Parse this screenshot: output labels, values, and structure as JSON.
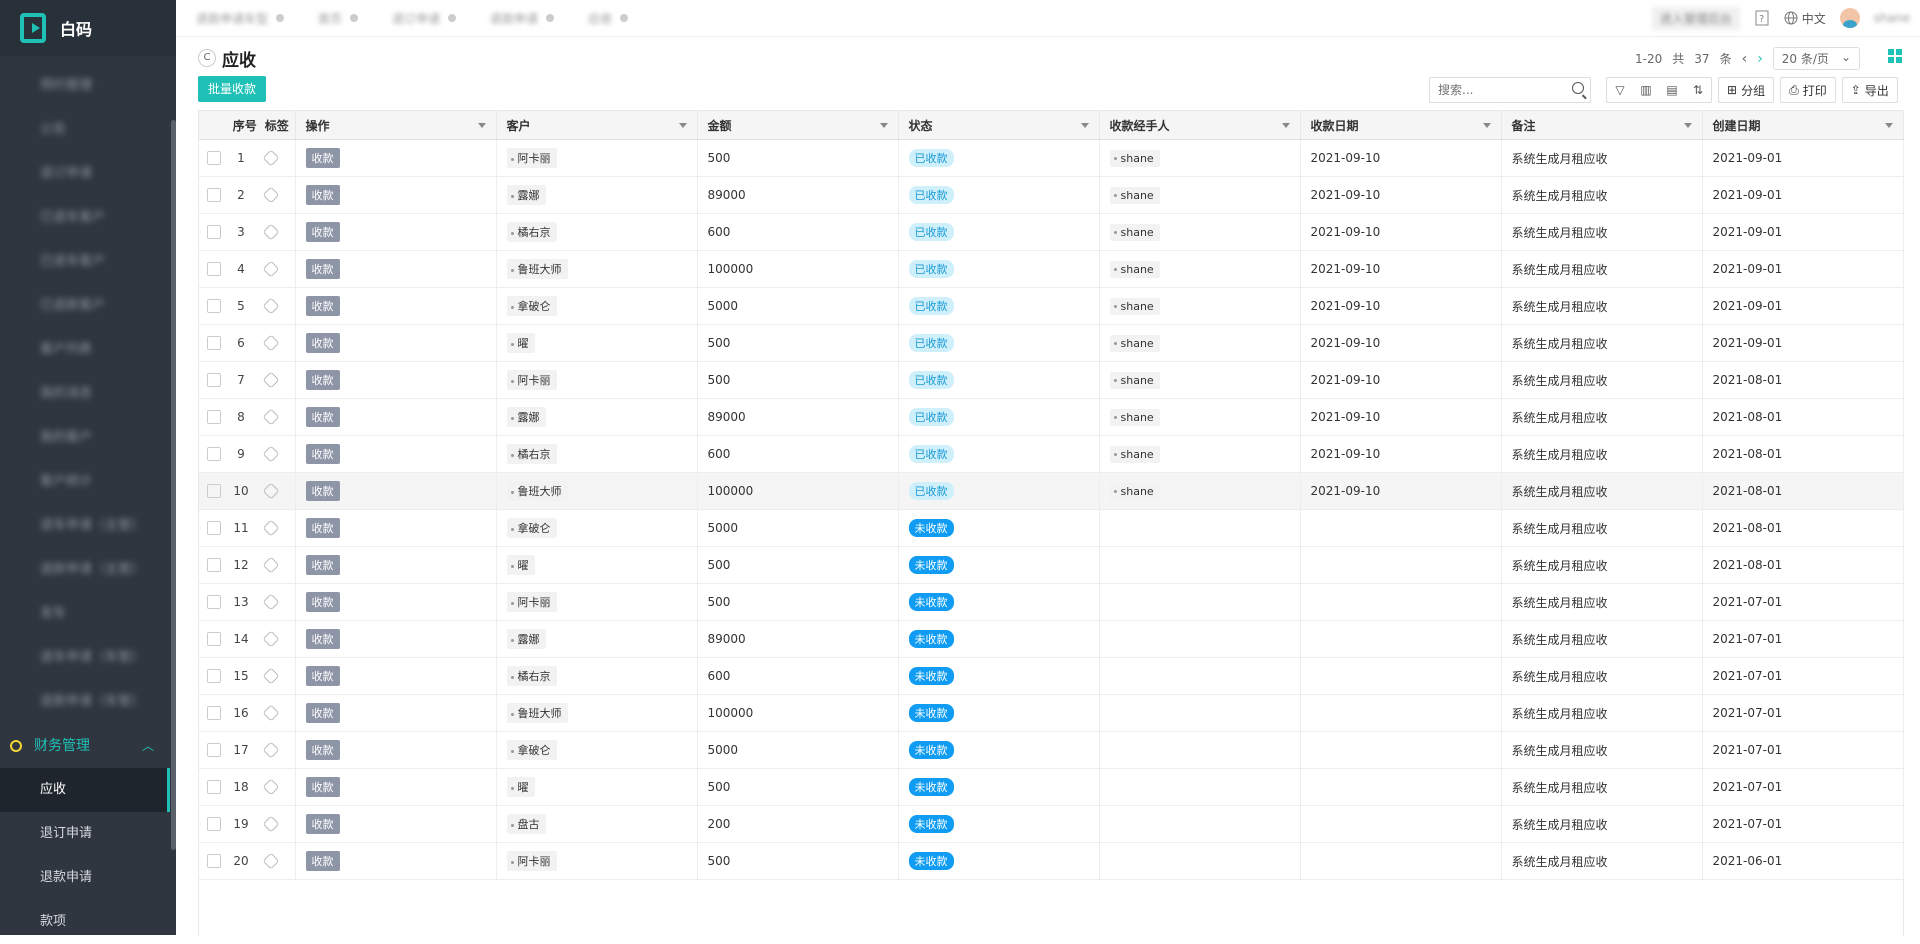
{
  "app": {
    "name": "白码"
  },
  "sidebar": {
    "blurred_items": [
      "预约管理",
      "公告",
      "退订申请",
      "已退车客户",
      "已退车客户",
      "已退款客户",
      "客户列表",
      "我的消息",
      "我的客户",
      "客户统计",
      "退车申请（主管）",
      "退款申请（主管）",
      "发车",
      "退车申请（车管）",
      "退款申请（车管）"
    ],
    "group": {
      "label": "财务管理"
    },
    "items": [
      {
        "label": "应收",
        "active": true
      },
      {
        "label": "退订申请"
      },
      {
        "label": "退款申请"
      },
      {
        "label": "款项"
      }
    ]
  },
  "topbar": {
    "tabs": [
      "退款申请车型",
      "首页",
      "退订申请",
      "退款申请",
      "应收"
    ],
    "manage_btn": "进入管理后台",
    "lang": "中文",
    "user": "shane"
  },
  "page": {
    "title": "应收",
    "batch_button": "批量收款",
    "search_placeholder": "搜索...",
    "group_label": "分组",
    "print_label": "打印",
    "export_label": "导出"
  },
  "pager": {
    "range": "1-20",
    "total_prefix": "共",
    "total": "37",
    "total_suffix": "条",
    "page_size": "20 条/页"
  },
  "table": {
    "columns": [
      "序号",
      "标签",
      "操作",
      "客户",
      "金额",
      "状态",
      "收款经手人",
      "收款日期",
      "备注",
      "创建日期"
    ],
    "rows": [
      {
        "no": "1",
        "op": "收款",
        "customer": "阿卡丽",
        "amount": "500",
        "status": "已收款",
        "handler": "shane",
        "paid_date": "2021-09-10",
        "note": "系统生成月租应收",
        "created": "2021-09-01"
      },
      {
        "no": "2",
        "op": "收款",
        "customer": "露娜",
        "amount": "89000",
        "status": "已收款",
        "handler": "shane",
        "paid_date": "2021-09-10",
        "note": "系统生成月租应收",
        "created": "2021-09-01"
      },
      {
        "no": "3",
        "op": "收款",
        "customer": "橘右京",
        "amount": "600",
        "status": "已收款",
        "handler": "shane",
        "paid_date": "2021-09-10",
        "note": "系统生成月租应收",
        "created": "2021-09-01"
      },
      {
        "no": "4",
        "op": "收款",
        "customer": "鲁班大师",
        "amount": "100000",
        "status": "已收款",
        "handler": "shane",
        "paid_date": "2021-09-10",
        "note": "系统生成月租应收",
        "created": "2021-09-01"
      },
      {
        "no": "5",
        "op": "收款",
        "customer": "拿破仑",
        "amount": "5000",
        "status": "已收款",
        "handler": "shane",
        "paid_date": "2021-09-10",
        "note": "系统生成月租应收",
        "created": "2021-09-01"
      },
      {
        "no": "6",
        "op": "收款",
        "customer": "曜",
        "amount": "500",
        "status": "已收款",
        "handler": "shane",
        "paid_date": "2021-09-10",
        "note": "系统生成月租应收",
        "created": "2021-09-01"
      },
      {
        "no": "7",
        "op": "收款",
        "customer": "阿卡丽",
        "amount": "500",
        "status": "已收款",
        "handler": "shane",
        "paid_date": "2021-09-10",
        "note": "系统生成月租应收",
        "created": "2021-08-01"
      },
      {
        "no": "8",
        "op": "收款",
        "customer": "露娜",
        "amount": "89000",
        "status": "已收款",
        "handler": "shane",
        "paid_date": "2021-09-10",
        "note": "系统生成月租应收",
        "created": "2021-08-01"
      },
      {
        "no": "9",
        "op": "收款",
        "customer": "橘右京",
        "amount": "600",
        "status": "已收款",
        "handler": "shane",
        "paid_date": "2021-09-10",
        "note": "系统生成月租应收",
        "created": "2021-08-01"
      },
      {
        "no": "10",
        "op": "收款",
        "customer": "鲁班大师",
        "amount": "100000",
        "status": "已收款",
        "handler": "shane",
        "paid_date": "2021-09-10",
        "note": "系统生成月租应收",
        "created": "2021-08-01"
      },
      {
        "no": "11",
        "op": "收款",
        "customer": "拿破仑",
        "amount": "5000",
        "status": "未收款",
        "handler": "",
        "paid_date": "",
        "note": "系统生成月租应收",
        "created": "2021-08-01"
      },
      {
        "no": "12",
        "op": "收款",
        "customer": "曜",
        "amount": "500",
        "status": "未收款",
        "handler": "",
        "paid_date": "",
        "note": "系统生成月租应收",
        "created": "2021-08-01"
      },
      {
        "no": "13",
        "op": "收款",
        "customer": "阿卡丽",
        "amount": "500",
        "status": "未收款",
        "handler": "",
        "paid_date": "",
        "note": "系统生成月租应收",
        "created": "2021-07-01"
      },
      {
        "no": "14",
        "op": "收款",
        "customer": "露娜",
        "amount": "89000",
        "status": "未收款",
        "handler": "",
        "paid_date": "",
        "note": "系统生成月租应收",
        "created": "2021-07-01"
      },
      {
        "no": "15",
        "op": "收款",
        "customer": "橘右京",
        "amount": "600",
        "status": "未收款",
        "handler": "",
        "paid_date": "",
        "note": "系统生成月租应收",
        "created": "2021-07-01"
      },
      {
        "no": "16",
        "op": "收款",
        "customer": "鲁班大师",
        "amount": "100000",
        "status": "未收款",
        "handler": "",
        "paid_date": "",
        "note": "系统生成月租应收",
        "created": "2021-07-01"
      },
      {
        "no": "17",
        "op": "收款",
        "customer": "拿破仑",
        "amount": "5000",
        "status": "未收款",
        "handler": "",
        "paid_date": "",
        "note": "系统生成月租应收",
        "created": "2021-07-01"
      },
      {
        "no": "18",
        "op": "收款",
        "customer": "曜",
        "amount": "500",
        "status": "未收款",
        "handler": "",
        "paid_date": "",
        "note": "系统生成月租应收",
        "created": "2021-07-01"
      },
      {
        "no": "19",
        "op": "收款",
        "customer": "盘古",
        "amount": "200",
        "status": "未收款",
        "handler": "",
        "paid_date": "",
        "note": "系统生成月租应收",
        "created": "2021-07-01"
      },
      {
        "no": "20",
        "op": "收款",
        "customer": "阿卡丽",
        "amount": "500",
        "status": "未收款",
        "handler": "",
        "paid_date": "",
        "note": "系统生成月租应收",
        "created": "2021-06-01"
      }
    ]
  },
  "colors": {
    "accent": "#1fc1b7",
    "sidebar_bg": "#2f3640",
    "paid_bg": "#cfeffb",
    "unpaid_bg": "#0f9cf2",
    "op_btn": "#8e95a7"
  }
}
